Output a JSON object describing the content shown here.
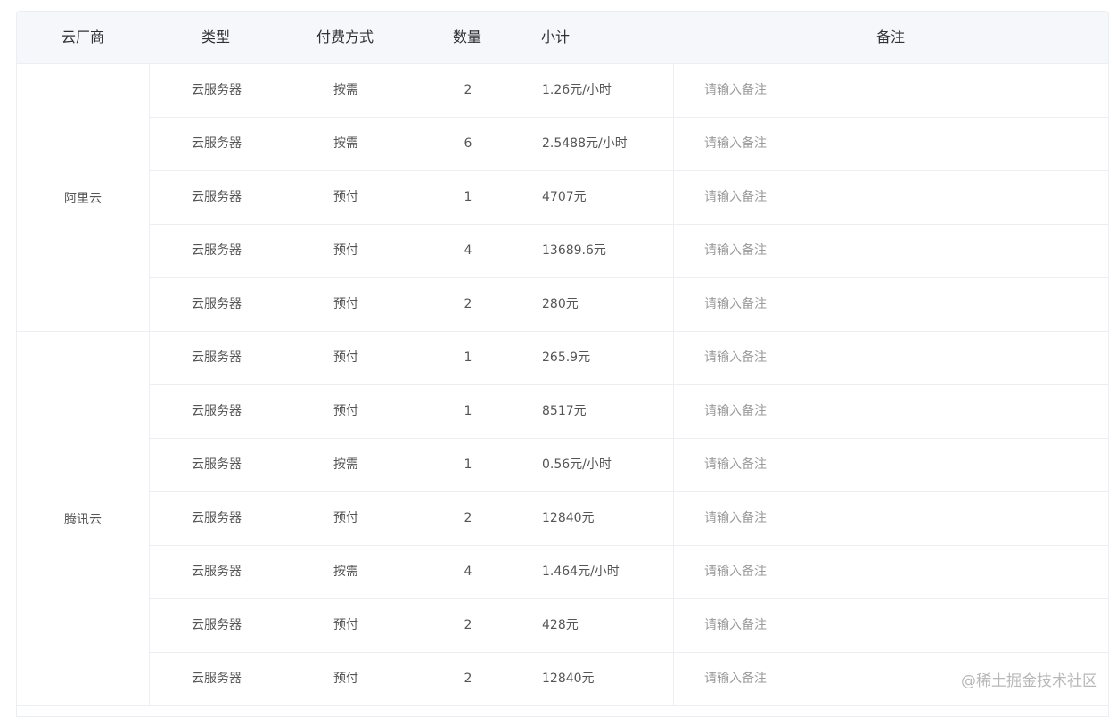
{
  "table": {
    "headers": {
      "vendor": "云厂商",
      "type": "类型",
      "payment": "付费方式",
      "quantity": "数量",
      "subtotal": "小计",
      "note": "备注"
    },
    "note_placeholder": "请输入备注",
    "groups": [
      {
        "vendor": "阿里云",
        "rows": [
          {
            "type": "云服务器",
            "payment": "按需",
            "quantity": "2",
            "subtotal": "1.26元/小时"
          },
          {
            "type": "云服务器",
            "payment": "按需",
            "quantity": "6",
            "subtotal": "2.5488元/小时"
          },
          {
            "type": "云服务器",
            "payment": "预付",
            "quantity": "1",
            "subtotal": "4707元"
          },
          {
            "type": "云服务器",
            "payment": "预付",
            "quantity": "4",
            "subtotal": "13689.6元"
          },
          {
            "type": "云服务器",
            "payment": "预付",
            "quantity": "2",
            "subtotal": "280元"
          }
        ]
      },
      {
        "vendor": "腾讯云",
        "rows": [
          {
            "type": "云服务器",
            "payment": "预付",
            "quantity": "1",
            "subtotal": "265.9元"
          },
          {
            "type": "云服务器",
            "payment": "预付",
            "quantity": "1",
            "subtotal": "8517元"
          },
          {
            "type": "云服务器",
            "payment": "按需",
            "quantity": "1",
            "subtotal": "0.56元/小时"
          },
          {
            "type": "云服务器",
            "payment": "预付",
            "quantity": "2",
            "subtotal": "12840元"
          },
          {
            "type": "云服务器",
            "payment": "按需",
            "quantity": "4",
            "subtotal": "1.464元/小时"
          },
          {
            "type": "云服务器",
            "payment": "预付",
            "quantity": "2",
            "subtotal": "428元"
          },
          {
            "type": "云服务器",
            "payment": "预付",
            "quantity": "2",
            "subtotal": "12840元"
          }
        ]
      }
    ]
  },
  "watermark": "@稀土掘金技术社区"
}
